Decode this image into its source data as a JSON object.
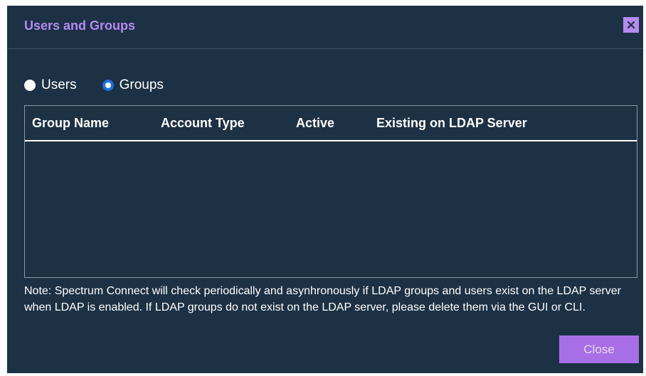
{
  "dialog": {
    "title": "Users and Groups",
    "close_icon": "close-icon",
    "colors": {
      "background": "#1c3144",
      "accent": "#b48af0",
      "button": "#a86ee6",
      "radio_selected": "#1e6fe0"
    }
  },
  "view_toggle": {
    "options": [
      {
        "label": "Users",
        "selected": false
      },
      {
        "label": "Groups",
        "selected": true
      }
    ]
  },
  "table": {
    "columns": [
      "Group Name",
      "Account Type",
      "Active",
      "Existing on LDAP Server"
    ],
    "rows": []
  },
  "note": "Note: Spectrum Connect will check periodically and asynhronously if LDAP groups and users exist on the LDAP server when LDAP is enabled. If LDAP groups do not exist on the LDAP server, please delete them via the GUI or CLI.",
  "footer": {
    "close_label": "Close"
  }
}
